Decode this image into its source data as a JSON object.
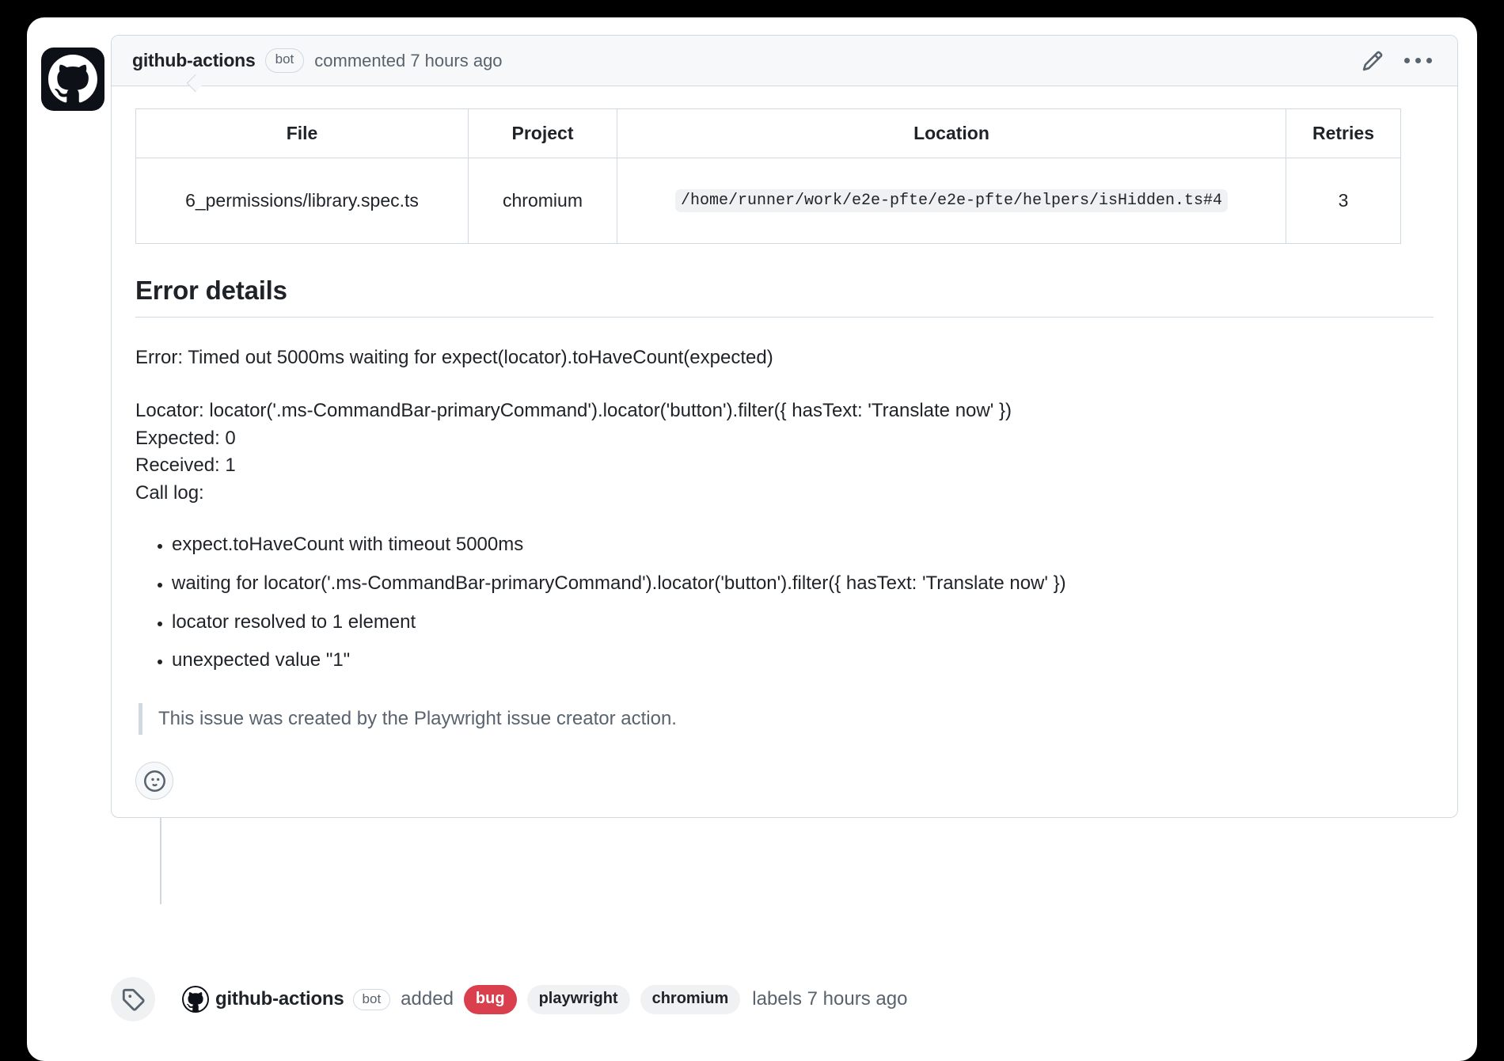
{
  "comment": {
    "author": "github-actions",
    "bot_badge": "bot",
    "meta": "commented 7 hours ago",
    "edit_icon": "pencil-icon",
    "menu_icon": "kebab-menu-icon",
    "avatar_icon": "github-logo-icon"
  },
  "table": {
    "headers": [
      "File",
      "Project",
      "Location",
      "Retries"
    ],
    "rows": [
      {
        "file": "6_permissions/library.spec.ts",
        "project": "chromium",
        "location": "/home/runner/work/e2e-pfte/e2e-pfte/helpers/isHidden.ts#4",
        "retries": "3"
      }
    ]
  },
  "error_section": {
    "heading": "Error details",
    "error_line": "Error: Timed out 5000ms waiting for expect(locator).toHaveCount(expected)",
    "locator_line": "Locator: locator('.ms-CommandBar-primaryCommand').locator('button').filter({ hasText: 'Translate now' })",
    "expected_line": "Expected: 0",
    "received_line": "Received: 1",
    "call_log_label": "Call log:",
    "call_log": [
      "expect.toHaveCount with timeout 5000ms",
      "waiting for locator('.ms-CommandBar-primaryCommand').locator('button').filter({ hasText: 'Translate now' })",
      "locator resolved to 1 element",
      "unexpected value \"1\""
    ],
    "note": "This issue was created by the Playwright issue creator action."
  },
  "reaction": {
    "icon": "smiley-icon"
  },
  "timeline": {
    "badge_icon": "tag-icon",
    "avatar_icon": "github-logo-icon",
    "author": "github-actions",
    "bot_badge": "bot",
    "verb": "added",
    "labels": [
      {
        "name": "bug",
        "color": "#d93f4c"
      },
      {
        "name": "playwright",
        "color": "#eff1f3"
      },
      {
        "name": "chromium",
        "color": "#eff1f3"
      }
    ],
    "tail": "labels 7 hours ago"
  }
}
